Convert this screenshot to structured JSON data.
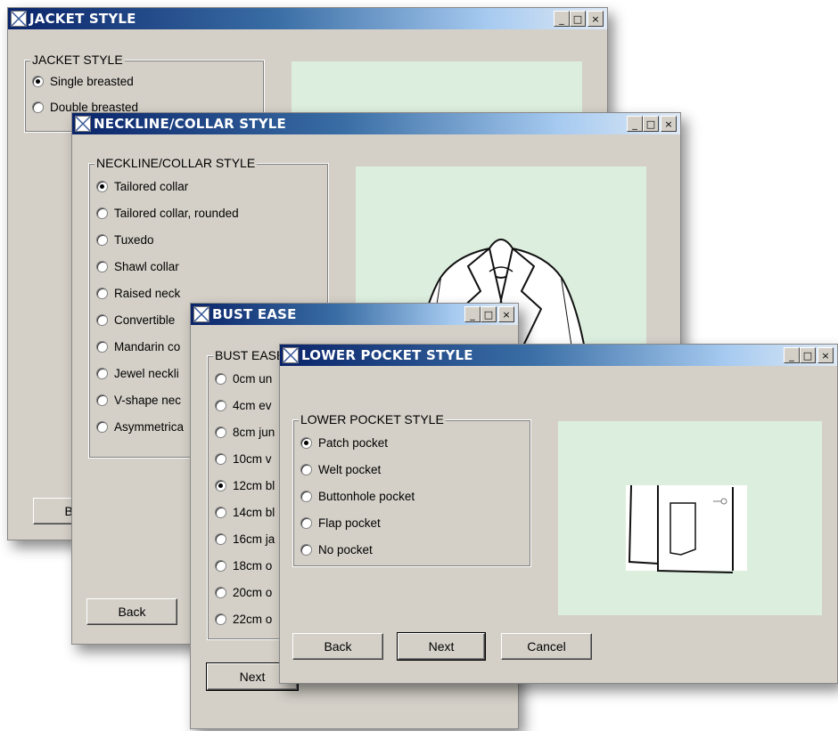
{
  "windows": {
    "jacket": {
      "title": "JACKET STYLE",
      "group_label": "JACKET STYLE",
      "options": [
        "Single breasted",
        "Double breasted"
      ],
      "selected": 0,
      "back_label": "Back"
    },
    "neckline": {
      "title": "NECKLINE/COLLAR STYLE",
      "group_label": "NECKLINE/COLLAR STYLE",
      "options": [
        "Tailored collar",
        "Tailored collar, rounded",
        "Tuxedo",
        "Shawl collar",
        "Raised neck",
        "Convertible",
        "Mandarin co",
        "Jewel neckli",
        "V-shape nec",
        "Asymmetrica"
      ],
      "selected": 0,
      "back_label": "Back"
    },
    "bust": {
      "title": "BUST EASE",
      "group_label": "BUST EASE",
      "options": [
        "0cm un",
        "4cm ev",
        "8cm jun",
        "10cm v",
        "12cm bl",
        "14cm bl",
        "16cm ja",
        "18cm o",
        "20cm o",
        "22cm o"
      ],
      "selected": 4,
      "next_label": "Next"
    },
    "pocket": {
      "title": "LOWER POCKET STYLE",
      "group_label": "LOWER POCKET STYLE",
      "options": [
        "Patch pocket",
        "Welt pocket",
        "Buttonhole pocket",
        "Flap pocket",
        "No pocket"
      ],
      "selected": 0,
      "back_label": "Back",
      "next_label": "Next",
      "cancel_label": "Cancel"
    }
  },
  "window_controls": {
    "minimize": "_",
    "maximize": "□",
    "close": "×"
  },
  "icons": {
    "window": "window-icon",
    "jacket_preview": "jacket-illustration",
    "pocket_preview": "pocket-illustration"
  },
  "colors": {
    "dialog_bg": "#d4d0c8",
    "preview_bg": "#dceede",
    "title_start": "#0a246a",
    "title_end": "#dfe9f5"
  }
}
